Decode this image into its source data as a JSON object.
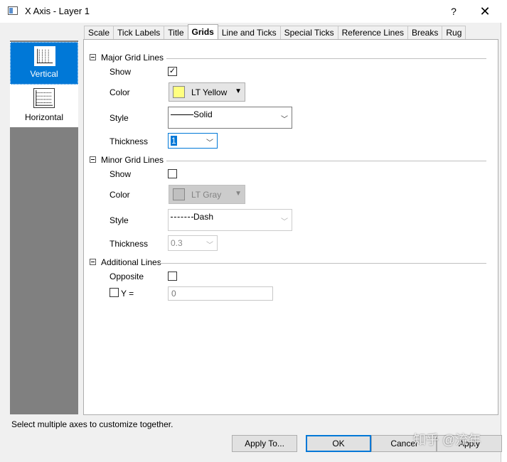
{
  "window": {
    "title": "X Axis - Layer 1",
    "help_label": "?",
    "close_label": "✕"
  },
  "sidebar": {
    "items": [
      {
        "label": "Vertical",
        "icon": "vertical-grid-icon",
        "selected": true
      },
      {
        "label": "Horizontal",
        "icon": "horizontal-grid-icon",
        "selected": false
      }
    ]
  },
  "tabs": [
    {
      "label": "Scale"
    },
    {
      "label": "Tick Labels"
    },
    {
      "label": "Title"
    },
    {
      "label": "Grids",
      "active": true
    },
    {
      "label": "Line and Ticks"
    },
    {
      "label": "Special Ticks"
    },
    {
      "label": "Reference Lines"
    },
    {
      "label": "Breaks"
    },
    {
      "label": "Rug"
    }
  ],
  "major": {
    "title": "Major Grid Lines",
    "show_label": "Show",
    "show_checked": "✓",
    "color_label": "Color",
    "color_value": "LT Yellow",
    "color_hex": "#ffff80",
    "style_label": "Style",
    "style_value": "Solid",
    "thickness_label": "Thickness",
    "thickness_value": "1"
  },
  "minor": {
    "title": "Minor Grid Lines",
    "show_label": "Show",
    "show_checked": "",
    "color_label": "Color",
    "color_value": "LT Gray",
    "color_hex": "#c0c0c0",
    "style_label": "Style",
    "style_value": "Dash",
    "thickness_label": "Thickness",
    "thickness_value": "0.3"
  },
  "additional": {
    "title": "Additional Lines",
    "opposite_label": "Opposite",
    "opposite_checked": "",
    "y_label": "Y =",
    "y_checked": "",
    "y_value": "0"
  },
  "status": {
    "text": "Select multiple axes to customize together."
  },
  "buttons": {
    "apply_to": "Apply To...",
    "ok": "OK",
    "cancel": "Cancel",
    "apply": "Apply"
  },
  "watermark": {
    "text": "知乎 @流年"
  },
  "colors": {
    "accent": "#0078d7",
    "sidebar_bg": "#808080"
  }
}
